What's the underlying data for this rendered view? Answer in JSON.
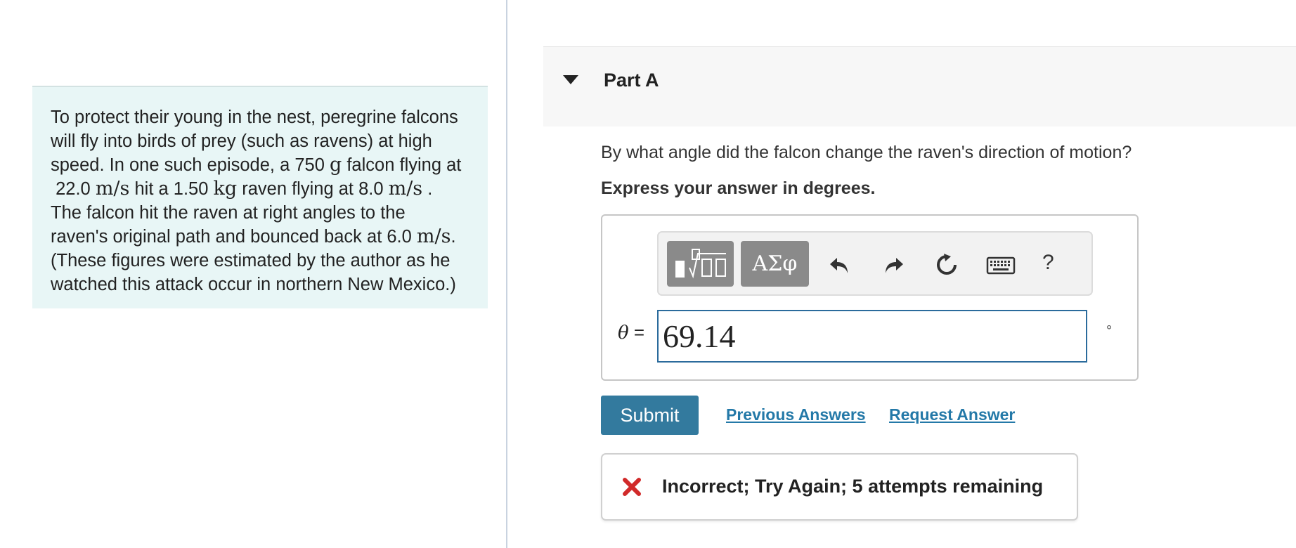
{
  "problem": {
    "line1": "To protect their young in the nest, peregrine falcons",
    "line2": "will fly into birds of prey (such as ravens) at high",
    "line3": "speed. In one such episode, a 750 ",
    "unit_g": "g",
    "line3b": " falcon flying at",
    "speed1": "22.0",
    "unit_ms": "m/s",
    "line4a": " hit a 1.50 ",
    "unit_kg": "kg",
    "line4b": " raven flying at 8.0 ",
    "line4c": ".",
    "line5": "The falcon hit the raven at right angles to the",
    "line6a": "raven's original path and bounced back at 6.0 ",
    "line6b": ".",
    "line7": "(These figures were estimated by the author as he",
    "line8": "watched this attack occur in northern New Mexico.)"
  },
  "part": {
    "title": "Part A"
  },
  "question": "By what angle did the falcon change the raven's direction of motion?",
  "instruction": "Express your answer in degrees.",
  "toolbar": {
    "greek_label": "ΑΣφ",
    "help_label": "?",
    "icons": [
      "templates-icon",
      "undo-icon",
      "redo-icon",
      "reset-icon",
      "keyboard-icon",
      "help-icon"
    ]
  },
  "answer": {
    "variable": "θ",
    "equals": "=",
    "value": "69.14",
    "unit": "°"
  },
  "actions": {
    "submit_label": "Submit",
    "previous_label": "Previous Answers",
    "request_label": "Request Answer"
  },
  "feedback": {
    "text": "Incorrect; Try Again; 5 attempts remaining",
    "color": "#d12a2a"
  },
  "colors": {
    "accent": "#337a9e",
    "link": "#2479a8",
    "panel": "#e8f6f6"
  }
}
